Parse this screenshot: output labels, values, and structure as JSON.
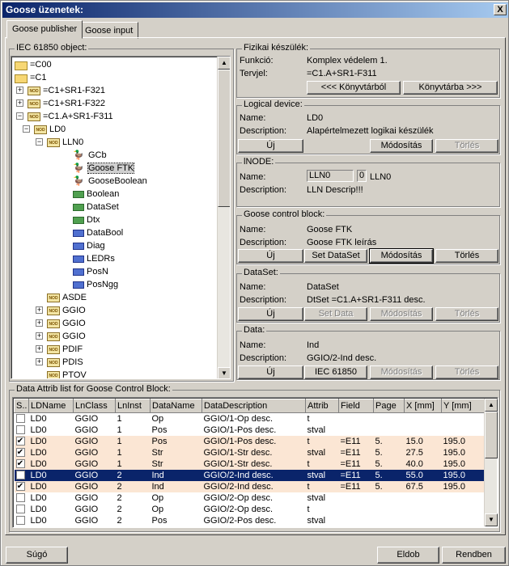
{
  "window": {
    "title": "Goose üzenetek:",
    "close": "X"
  },
  "tabs": [
    {
      "label": "Goose publisher"
    },
    {
      "label": "Goose input"
    }
  ],
  "tree": {
    "label": "IEC 61850 object:",
    "nodes": [
      "=C00",
      "=C1",
      "=C1+SR1-F321",
      "=C1+SR1-F322",
      "=C1.A+SR1-F311",
      "LD0",
      "LLN0",
      "GCb",
      "Goose FTK",
      "GooseBoolean",
      "Boolean",
      "DataSet",
      "Dtx",
      "DataBool",
      "Diag",
      "LEDRs",
      "PosN",
      "PosNgg",
      "ASDE",
      "GGIO",
      "GGIO",
      "GGIO",
      "PDIF",
      "PDIS",
      "PTOV"
    ]
  },
  "device": {
    "label": "Fizikai készülék:",
    "func_label": "Funkció:",
    "func_value": "Komplex védelem 1.",
    "tervjel_label": "Tervjel:",
    "tervjel_value": "=C1.A+SR1-F311",
    "btn_from": "<<< Könyvtárból",
    "btn_to": "Könyvtárba >>>"
  },
  "ld": {
    "label": "Logical device:",
    "name_label": "Name:",
    "name_value": "LD0",
    "desc_label": "Description:",
    "desc_value": "Alapértelmezett logikai készülék",
    "btn_new": "Új",
    "btn_mod": "Módosítás",
    "btn_del": "Törlés"
  },
  "ln": {
    "label": "lNODE:",
    "name_label": "Name:",
    "name_value": "LLN0",
    "inst_value": "0",
    "full_value": "LLN0",
    "desc_label": "Description:",
    "desc_value": "LLN Descrip!!!"
  },
  "gcb": {
    "label": "Goose control block:",
    "name_label": "Name:",
    "name_value": "Goose FTK",
    "desc_label": "Description:",
    "desc_value": "Goose FTK leírás",
    "btn_new": "Új",
    "btn_set": "Set DataSet",
    "btn_mod": "Módosítás",
    "btn_del": "Törlés"
  },
  "ds": {
    "label": "DataSet:",
    "name_label": "Name:",
    "name_value": "DataSet",
    "desc_label": "Description:",
    "desc_value": "DtSet =C1.A+SR1-F311 desc.",
    "btn_new": "Új",
    "btn_set": "Set Data",
    "btn_mod": "Módosítás",
    "btn_del": "Törlés"
  },
  "data": {
    "label": "Data:",
    "name_label": "Name:",
    "name_value": "Ind",
    "desc_label": "Description:",
    "desc_value": "GGIO/2-Ind desc.",
    "btn_new": "Új",
    "btn_iec": "IEC 61850",
    "btn_mod": "Módosítás",
    "btn_del": "Törlés"
  },
  "grid": {
    "label": "Data Attrib list for Goose Control Block:",
    "columns": [
      "S..",
      "LDName",
      "LnClass",
      "LnInst",
      "DataName",
      "DataDescription",
      "Attrib",
      "Field",
      "Page",
      "X [mm]",
      "Y [mm]"
    ],
    "rows": [
      {
        "checked": false,
        "style": "",
        "cells": [
          "LD0",
          "GGIO",
          "1",
          "Op",
          "GGIO/1-Op desc.",
          "t",
          "",
          "",
          "",
          ""
        ]
      },
      {
        "checked": false,
        "style": "",
        "cells": [
          "LD0",
          "GGIO",
          "1",
          "Pos",
          "GGIO/1-Pos desc.",
          "stval",
          "",
          "",
          "",
          ""
        ]
      },
      {
        "checked": true,
        "style": "orange",
        "cells": [
          "LD0",
          "GGIO",
          "1",
          "Pos",
          "GGIO/1-Pos desc.",
          "t",
          "=E11",
          "5.",
          "15.0",
          "195.0"
        ]
      },
      {
        "checked": true,
        "style": "orange",
        "cells": [
          "LD0",
          "GGIO",
          "1",
          "Str",
          "GGIO/1-Str desc.",
          "stval",
          "=E11",
          "5.",
          "27.5",
          "195.0"
        ]
      },
      {
        "checked": true,
        "style": "orange",
        "cells": [
          "LD0",
          "GGIO",
          "1",
          "Str",
          "GGIO/1-Str desc.",
          "t",
          "=E11",
          "5.",
          "40.0",
          "195.0"
        ]
      },
      {
        "checked": true,
        "style": "hl",
        "cells": [
          "LD0",
          "GGIO",
          "2",
          "Ind",
          "GGIO/2-Ind desc.",
          "stval",
          "=E11",
          "5.",
          "55.0",
          "195.0"
        ]
      },
      {
        "checked": true,
        "style": "orange",
        "cells": [
          "LD0",
          "GGIO",
          "2",
          "Ind",
          "GGIO/2-Ind desc.",
          "t",
          "=E11",
          "5.",
          "67.5",
          "195.0"
        ]
      },
      {
        "checked": false,
        "style": "",
        "cells": [
          "LD0",
          "GGIO",
          "2",
          "Op",
          "GGIO/2-Op desc.",
          "stval",
          "",
          "",
          "",
          ""
        ]
      },
      {
        "checked": false,
        "style": "",
        "cells": [
          "LD0",
          "GGIO",
          "2",
          "Op",
          "GGIO/2-Op desc.",
          "t",
          "",
          "",
          "",
          ""
        ]
      },
      {
        "checked": false,
        "style": "",
        "cells": [
          "LD0",
          "GGIO",
          "2",
          "Pos",
          "GGIO/2-Pos desc.",
          "stval",
          "",
          "",
          "",
          ""
        ]
      }
    ]
  },
  "footer": {
    "help": "Súgó",
    "arrange": "Eldob",
    "ok": "Rendben"
  }
}
